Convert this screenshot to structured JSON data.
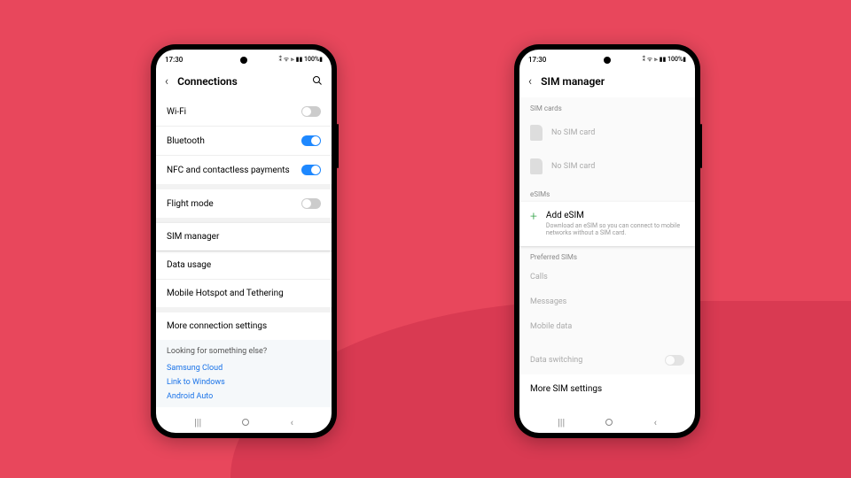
{
  "status": {
    "time": "17:30",
    "signal": "⁑ ᯤ ⫸ ▮▮ 100%▮"
  },
  "left": {
    "title": "Connections",
    "items": {
      "wifi": "Wi-Fi",
      "bluetooth": "Bluetooth",
      "nfc": "NFC and contactless payments",
      "flight": "Flight mode",
      "sim": "SIM manager",
      "data": "Data usage",
      "hotspot": "Mobile Hotspot and Tethering",
      "more": "More connection settings"
    },
    "footer": {
      "head": "Looking for something else?",
      "links": [
        "Samsung Cloud",
        "Link to Windows",
        "Android Auto"
      ]
    }
  },
  "right": {
    "title": "SIM manager",
    "sections": {
      "simcards": "SIM cards",
      "nosim": "No SIM card",
      "esims": "eSIMs",
      "add_title": "Add eSIM",
      "add_sub": "Download an eSIM so you can connect to mobile networks without a SIM card.",
      "preferred": "Preferred SIMs",
      "calls": "Calls",
      "messages": "Messages",
      "mobiledata": "Mobile data",
      "dataswitch": "Data switching",
      "more": "More SIM settings"
    }
  }
}
